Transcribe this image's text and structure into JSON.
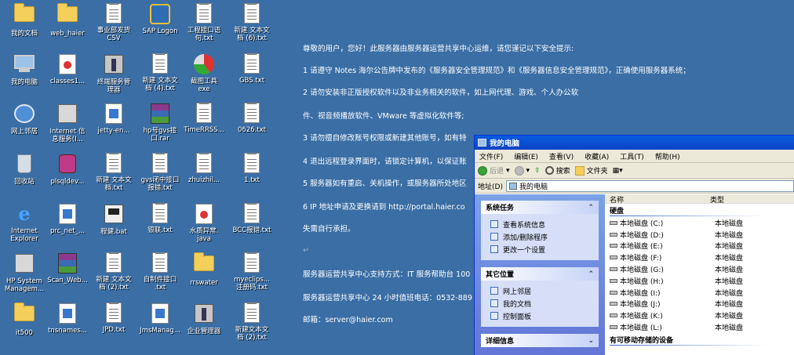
{
  "desktop_icons": [
    {
      "label": "我的文档",
      "icon": "folder-docs-icon"
    },
    {
      "label": "web_haier",
      "icon": "folder-icon"
    },
    {
      "label": "事业部发货\nCSV",
      "icon": "text-file-icon"
    },
    {
      "label": "SAP Logon",
      "icon": "sap-icon"
    },
    {
      "label": "工程接口语\n句.txt",
      "icon": "text-file-icon"
    },
    {
      "label": "新建 文本文\n档 (6).txt",
      "icon": "text-file-icon"
    },
    {
      "label": "我的电脑",
      "icon": "computer-icon"
    },
    {
      "label": "classes1...",
      "icon": "java-file-icon"
    },
    {
      "label": "终端服务管\n理器",
      "icon": "terminal-manager-icon"
    },
    {
      "label": "新建 文本文\n档 (4).txt",
      "icon": "text-file-icon"
    },
    {
      "label": "截图工具\nexe",
      "icon": "screenshot-tool-icon"
    },
    {
      "label": "GBS.txt",
      "icon": "text-file-icon"
    },
    {
      "label": "网上邻居",
      "icon": "network-icon"
    },
    {
      "label": "Internet 信\n息服务(I...",
      "icon": "iis-icon"
    },
    {
      "label": "jetty-en...",
      "icon": "doc-file-icon"
    },
    {
      "label": "hp号gvs接\n口.rar",
      "icon": "rar-icon"
    },
    {
      "label": "TimeRRSS...",
      "icon": "text-file-icon"
    },
    {
      "label": "0626.txt",
      "icon": "text-file-icon"
    },
    {
      "label": "回收站",
      "icon": "recycle-bin-icon"
    },
    {
      "label": "plsqldev...",
      "icon": "plsql-icon"
    },
    {
      "label": "新建 文本文\n档.txt",
      "icon": "text-file-icon"
    },
    {
      "label": "gvs闭中接口\n报错.txt",
      "icon": "text-file-icon"
    },
    {
      "label": "zhuizhil...",
      "icon": "text-file-icon"
    },
    {
      "label": "1.txt",
      "icon": "text-file-icon"
    },
    {
      "label": "Internet\nExplorer",
      "icon": "ie-icon"
    },
    {
      "label": "prc_net_...",
      "icon": "sql-file-icon"
    },
    {
      "label": "程健.bat",
      "icon": "bat-icon"
    },
    {
      "label": "银联.txt",
      "icon": "text-file-icon"
    },
    {
      "label": "水质异常.\njava",
      "icon": "java-file-icon"
    },
    {
      "label": "BCC报错.txt",
      "icon": "text-file-icon"
    },
    {
      "label": "HP System\nManagem...",
      "icon": "hp-system-icon"
    },
    {
      "label": "Scan_Web...",
      "icon": "rar-icon"
    },
    {
      "label": "新建 文本文\n档 (2).txt",
      "icon": "text-file-icon"
    },
    {
      "label": "自制件接口\n.txt",
      "icon": "text-file-icon"
    },
    {
      "label": "rrswater",
      "icon": "folder-icon"
    },
    {
      "label": "myeclips...\n注册码.txt",
      "icon": "text-file-icon"
    },
    {
      "label": "it500",
      "icon": "folder-icon"
    },
    {
      "label": "tnsnames...",
      "icon": "doc-file-icon"
    },
    {
      "label": "JPD.txt",
      "icon": "text-file-icon"
    },
    {
      "label": "JmsManag...",
      "icon": "doc-file-icon"
    },
    {
      "label": "企业管理器",
      "icon": "enterprise-manager-icon"
    },
    {
      "label": "新建文本文\n档 (2).txt",
      "icon": "text-file-icon"
    }
  ],
  "notice": {
    "greeting": "尊敬的用户，您好！此服务器由服务器运营共享中心运维，请您谨记以下安全提示:",
    "line1": "1 请遵守 Notes 海尔公告牌中发布的《服务器安全管理规范》和《服务器信息安全管理规范》，正确使用服务器系统；",
    "line2a": "2 请勿安装非正版授权软件以及非业务相关的软件，如上网代理、游戏、个人办公软",
    "line2b": "件、视音频播放软件、VMware 等虚拟化软件等;",
    "line3": "3 请勿擅自修改账号权限或新建其他账号，如有特",
    "line4": "4 退出远程登录界面时，请锁定计算机，以保证账",
    "line5": "5 服务器如有重启、关机操作，或服务器所处地区",
    "line6": "6 IP 地址申请及更换请到 http://portal.haier.co",
    "line7": "失需自行承担。",
    "support": "服务器运营共享中心支持方式：IT 服务帮助台 100",
    "hotline": "服务器运营共享中心 24 小时值班电话：0532-889",
    "email": "邮箱：server@haier.com",
    "pilcrow": "↵"
  },
  "window": {
    "title": "我的电脑",
    "menu": [
      "文件(F)",
      "编辑(E)",
      "查看(V)",
      "收藏(A)",
      "工具(T)",
      "帮助(H)"
    ],
    "toolbar": {
      "back": "后退",
      "search": "搜索",
      "folders": "文件夹"
    },
    "address_label": "地址(D)",
    "address_value": "我的电脑",
    "tasks": {
      "system_title": "系统任务",
      "system_items": [
        "查看系统信息",
        "添加/删除程序",
        "更改一个设置"
      ],
      "other_title": "其它位置",
      "other_items": [
        "网上邻居",
        "我的文档",
        "控制面板"
      ],
      "details_title": "详细信息"
    },
    "columns": {
      "name": "名称",
      "type": "类型"
    },
    "group_hdd": "硬盘",
    "drives": [
      {
        "name": "本地磁盘 (C:)",
        "type": "本地磁盘"
      },
      {
        "name": "本地磁盘 (D:)",
        "type": "本地磁盘"
      },
      {
        "name": "本地磁盘 (E:)",
        "type": "本地磁盘"
      },
      {
        "name": "本地磁盘 (F:)",
        "type": "本地磁盘"
      },
      {
        "name": "本地磁盘 (G:)",
        "type": "本地磁盘"
      },
      {
        "name": "本地磁盘 (H:)",
        "type": "本地磁盘"
      },
      {
        "name": "本地磁盘 (I:)",
        "type": "本地磁盘"
      },
      {
        "name": "本地磁盘 (J:)",
        "type": "本地磁盘"
      },
      {
        "name": "本地磁盘 (K:)",
        "type": "本地磁盘"
      },
      {
        "name": "本地磁盘 (L:)",
        "type": "本地磁盘"
      }
    ],
    "group_removable": "有可移动存储的设备"
  }
}
